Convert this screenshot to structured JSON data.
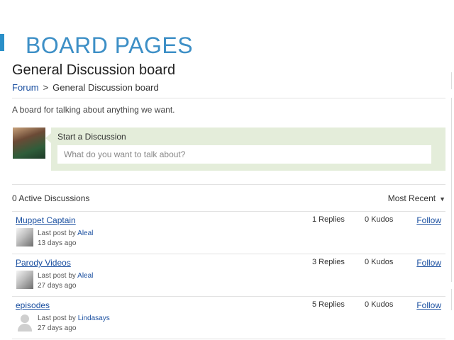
{
  "slide": {
    "title": "BOARD PAGES"
  },
  "board": {
    "title": "General Discussion board",
    "breadcrumb": {
      "root": "Forum",
      "separator": ">",
      "current": "General Discussion board"
    },
    "description": "A board for talking about anything we want."
  },
  "start_discussion": {
    "label": "Start a Discussion",
    "placeholder": "What do you want to talk about?"
  },
  "discussions": {
    "count_label": "0 Active Discussions",
    "sort_label": "Most Recent",
    "items": [
      {
        "title": "Muppet Captain",
        "last_post_prefix": "Last post by",
        "author": "Aleal",
        "age": "13 days ago",
        "replies": "1 Replies",
        "kudos": "0 Kudos",
        "follow": "Follow"
      },
      {
        "title": "Parody Videos",
        "last_post_prefix": "Last post by",
        "author": "Aleal",
        "age": "27 days ago",
        "replies": "3 Replies",
        "kudos": "0 Kudos",
        "follow": "Follow"
      },
      {
        "title": "episodes",
        "last_post_prefix": "Last post by",
        "author": "Lindasays",
        "age": "27 days ago",
        "replies": "5 Replies",
        "kudos": "0 Kudos",
        "follow": "Follow"
      }
    ]
  },
  "colors": {
    "accent": "#3d8fc6",
    "link": "#1a4fa0",
    "start_box_bg": "#e4edda"
  }
}
